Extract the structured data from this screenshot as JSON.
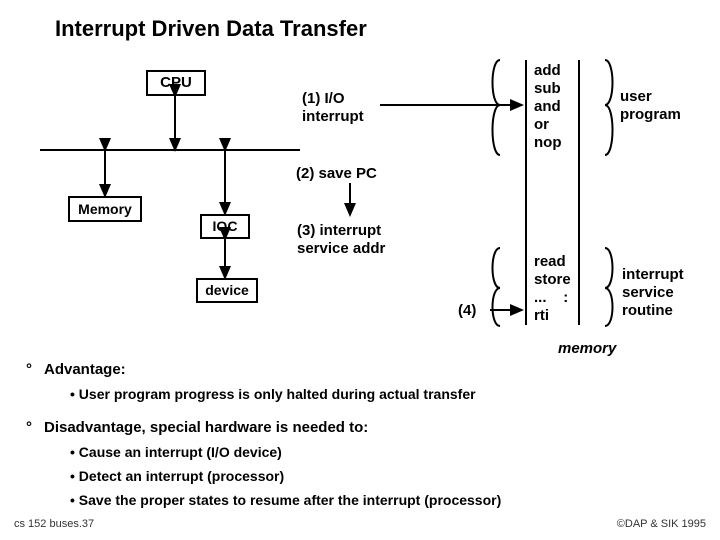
{
  "title": "Interrupt Driven Data Transfer",
  "blocks": {
    "cpu": "CPU",
    "memory": "Memory",
    "ioc": "IOC",
    "device": "device"
  },
  "steps": {
    "s1_l1": "(1) I/O",
    "s1_l2": "interrupt",
    "s2": "(2) save PC",
    "s3_l1": "(3) interrupt",
    "s3_l2": "service addr",
    "s4": "(4)"
  },
  "mem": {
    "user": {
      "i1": "add",
      "i2": "sub",
      "i3": "and",
      "i4": "or",
      "i5": "nop"
    },
    "svc": {
      "i1": "read",
      "i2": "store",
      "i3": "...",
      "colon": ":",
      "i4": "rti"
    }
  },
  "labels": {
    "user_l1": "user",
    "user_l2": "program",
    "isr_l1": "interrupt",
    "isr_l2": "service",
    "isr_l3": "routine",
    "memory": "memory"
  },
  "bullets": {
    "adv_head": "Advantage:",
    "adv_1": "User program progress is only halted during actual transfer",
    "dis_head": "Disadvantage,  special hardware is needed to:",
    "dis_1": "Cause an interrupt (I/O device)",
    "dis_2": "Detect an interrupt (processor)",
    "dis_3": "Save the proper states to resume after the interrupt (processor)"
  },
  "footer": {
    "left": "cs 152  buses.37",
    "right": "©DAP & SIK 1995"
  }
}
